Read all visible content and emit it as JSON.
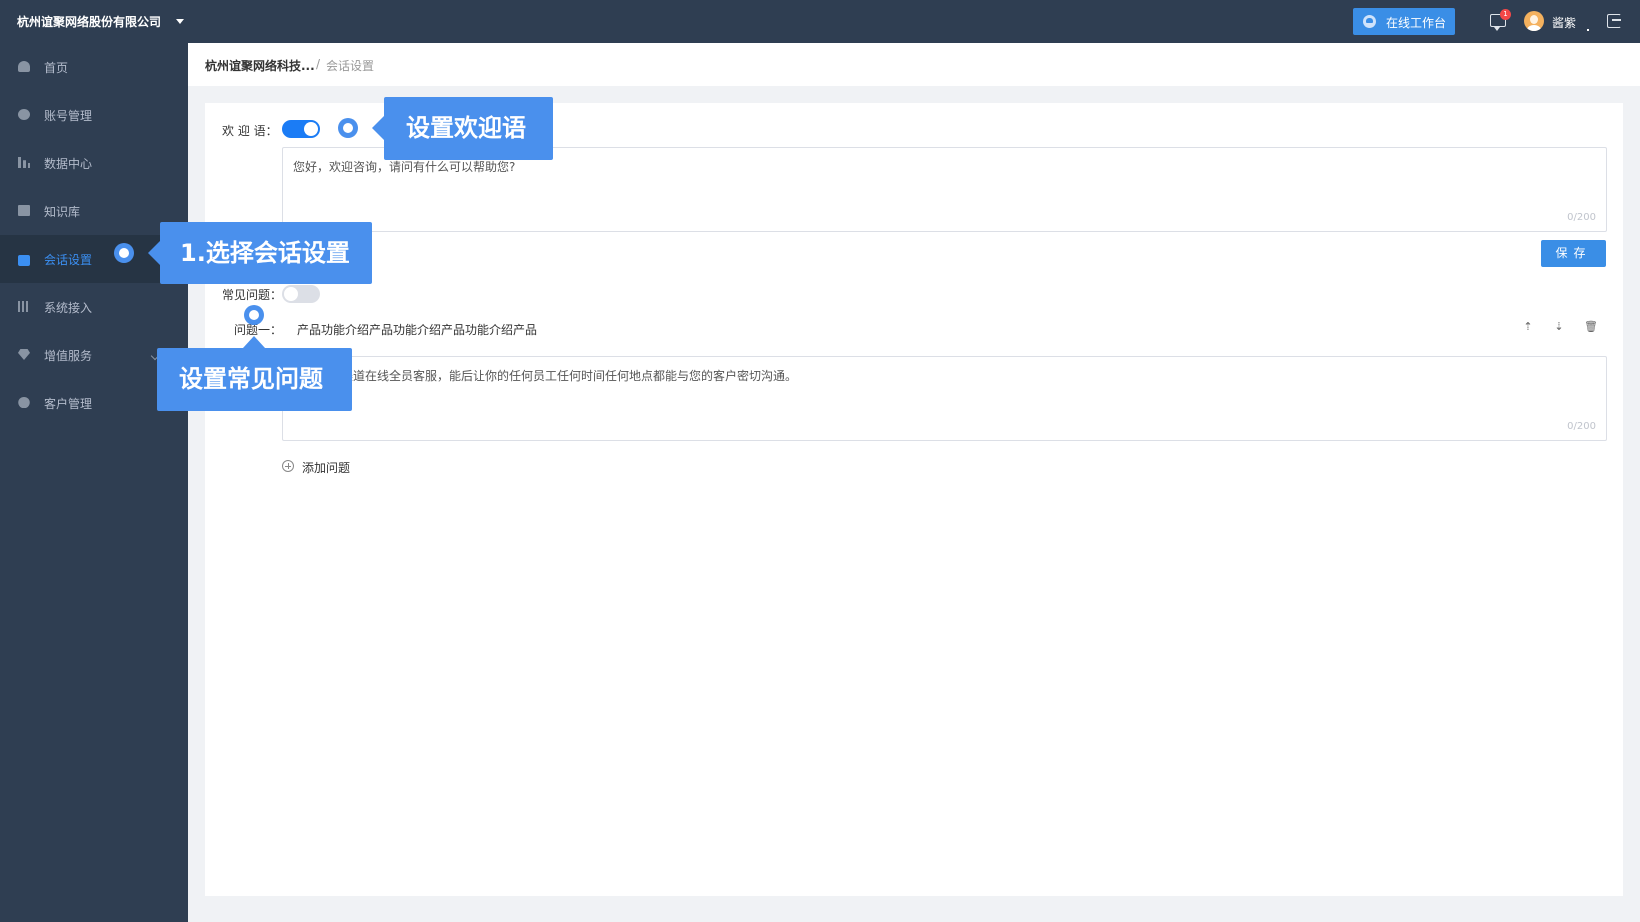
{
  "topbar": {
    "company": "杭州谊聚网络股份有限公司",
    "workbench_label": "在线工作台",
    "message_badge": "1",
    "username": "酱紫"
  },
  "sidebar": {
    "items": [
      {
        "label": "首页",
        "icon": "dashboard-icon"
      },
      {
        "label": "账号管理",
        "icon": "account-icon"
      },
      {
        "label": "数据中心",
        "icon": "bar-chart-icon"
      },
      {
        "label": "知识库",
        "icon": "book-icon"
      },
      {
        "label": "会话设置",
        "icon": "chat-icon",
        "active": true
      },
      {
        "label": "系统接入",
        "icon": "sliders-icon"
      },
      {
        "label": "增值服务",
        "icon": "diamond-icon"
      },
      {
        "label": "客户管理",
        "icon": "user-icon"
      }
    ]
  },
  "breadcrumb": {
    "company": "杭州谊聚网络科技...",
    "separator": "/",
    "current": "会话设置"
  },
  "welcome": {
    "label": "欢 迎 语：",
    "enabled": true,
    "text": "您好，欢迎咨询，请问有什么可以帮助您?",
    "counter": "0/200",
    "save_label": "保存"
  },
  "faq": {
    "label": "常见问题：",
    "enabled": false,
    "question_label": "问题一：",
    "question": "产品功能介绍产品功能介绍产品功能介绍产品",
    "answer": "是一款多渠道在线全员客服，能后让你的任何员工任何时间任何地点都能与您的客户密切沟通。",
    "counter": "0/200",
    "add_label": "添加问题"
  },
  "callouts": {
    "welcome": "设置欢迎语",
    "select": "1.选择会话设置",
    "faq": "设置常见问题"
  },
  "colors": {
    "topbar": "#2f3e52",
    "accent": "#3a8ee6",
    "callout": "#4a90ed"
  }
}
